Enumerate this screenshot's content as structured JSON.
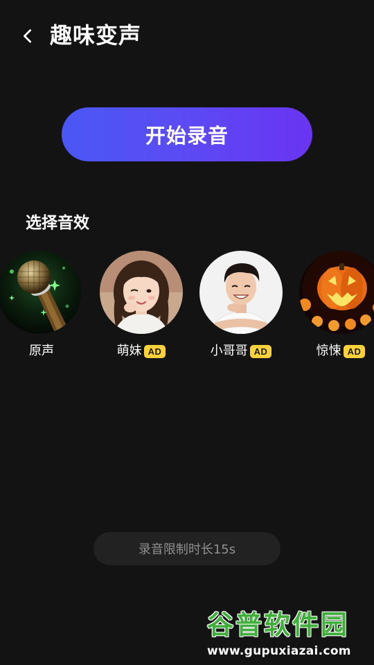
{
  "header": {
    "back_icon": "chevron-left-icon",
    "title": "趣味变声"
  },
  "record_button": {
    "label": "开始录音"
  },
  "effects_section": {
    "title": "选择音效",
    "items": [
      {
        "label": "原声",
        "image": "microphone",
        "ad": false
      },
      {
        "label": "萌妹",
        "image": "girl-portrait",
        "ad": true,
        "ad_label": "AD"
      },
      {
        "label": "小哥哥",
        "image": "boy-portrait",
        "ad": true,
        "ad_label": "AD"
      },
      {
        "label": "惊悚",
        "image": "halloween-pumpkin",
        "ad": true,
        "ad_label": "AD"
      }
    ]
  },
  "limit_note": "录音限制时长15s",
  "watermark": {
    "title": "谷普软件园",
    "url": "www.gupuxiazai.com"
  },
  "colors": {
    "background": "#131313",
    "button_gradient_start": "#4a57f5",
    "button_gradient_end": "#6a34f2",
    "ad_badge": "#ffd23a",
    "pill_background": "#222222",
    "muted_text": "#8f8f8f"
  }
}
